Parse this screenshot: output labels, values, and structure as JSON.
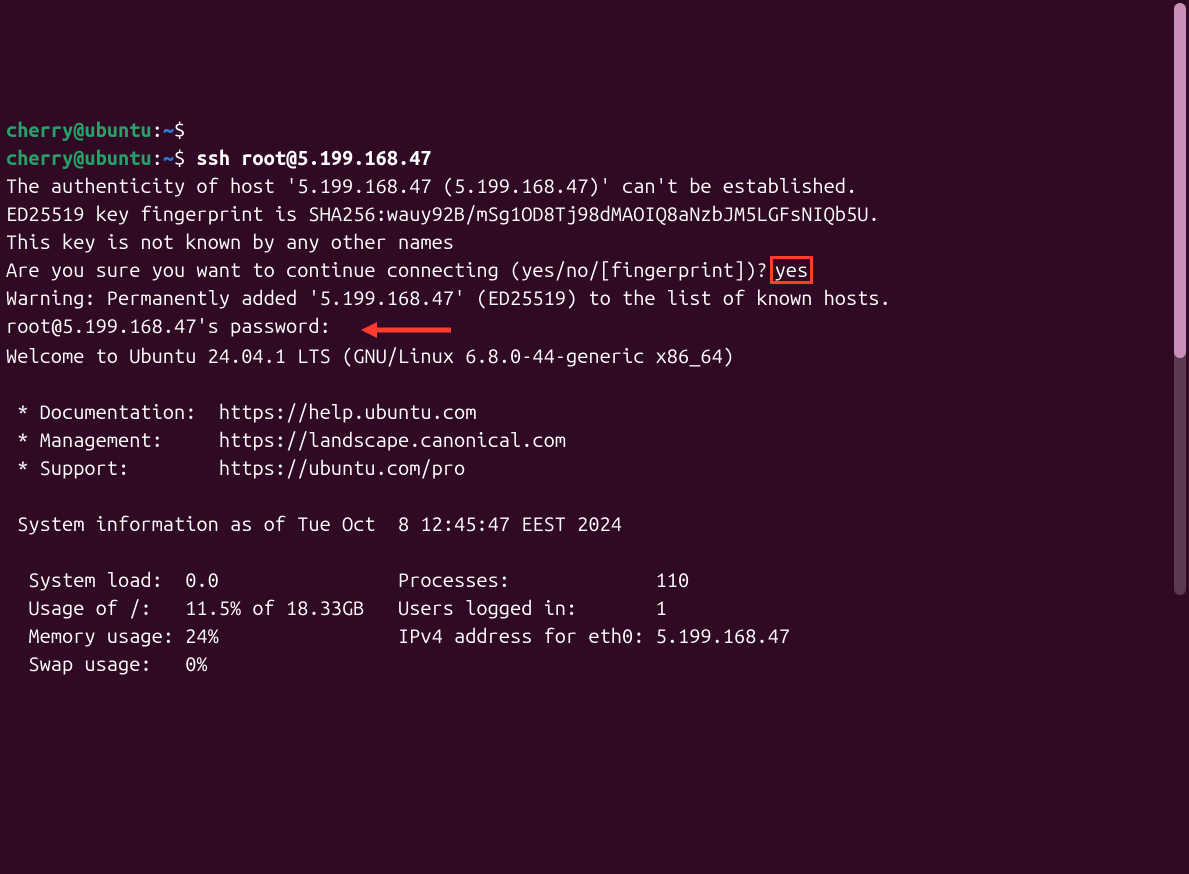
{
  "prompt1": {
    "user": "cherry@ubuntu",
    "path": "~",
    "sep": ":",
    "symbol": "$"
  },
  "prompt2": {
    "user": "cherry@ubuntu",
    "path": "~",
    "sep": ":",
    "symbol": "$",
    "command": "ssh root@5.199.168.47"
  },
  "ssh": {
    "auth_line": "The authenticity of host '5.199.168.47 (5.199.168.47)' can't be established.",
    "fingerprint_line": "ED25519 key fingerprint is SHA256:wauy92B/mSg1OD8Tj98dMAOIQ8aNzbJM5LGFsNIQb5U.",
    "not_known_line": "This key is not known by any other names",
    "confirm_prompt": "Are you sure you want to continue connecting (yes/no/[fingerprint])?",
    "confirm_answer": "yes",
    "warning_line": "Warning: Permanently added '5.199.168.47' (ED25519) to the list of known hosts.",
    "password_prompt": "root@5.199.168.47's password:"
  },
  "motd": {
    "welcome": "Welcome to Ubuntu 24.04.1 LTS (GNU/Linux 6.8.0-44-generic x86_64)",
    "doc_label": " * Documentation:  ",
    "doc_url": "https://help.ubuntu.com",
    "mgmt_label": " * Management:     ",
    "mgmt_url": "https://landscape.canonical.com",
    "support_label": " * Support:        ",
    "support_url": "https://ubuntu.com/pro",
    "sysinfo_header": " System information as of Tue Oct  8 12:45:47 EEST 2024",
    "row1": "  System load:  0.0                Processes:             110",
    "row2": "  Usage of /:   11.5% of 18.33GB   Users logged in:       1",
    "row3": "  Memory usage: 24%                IPv4 address for eth0: 5.199.168.47",
    "row4": "  Swap usage:   0%"
  }
}
